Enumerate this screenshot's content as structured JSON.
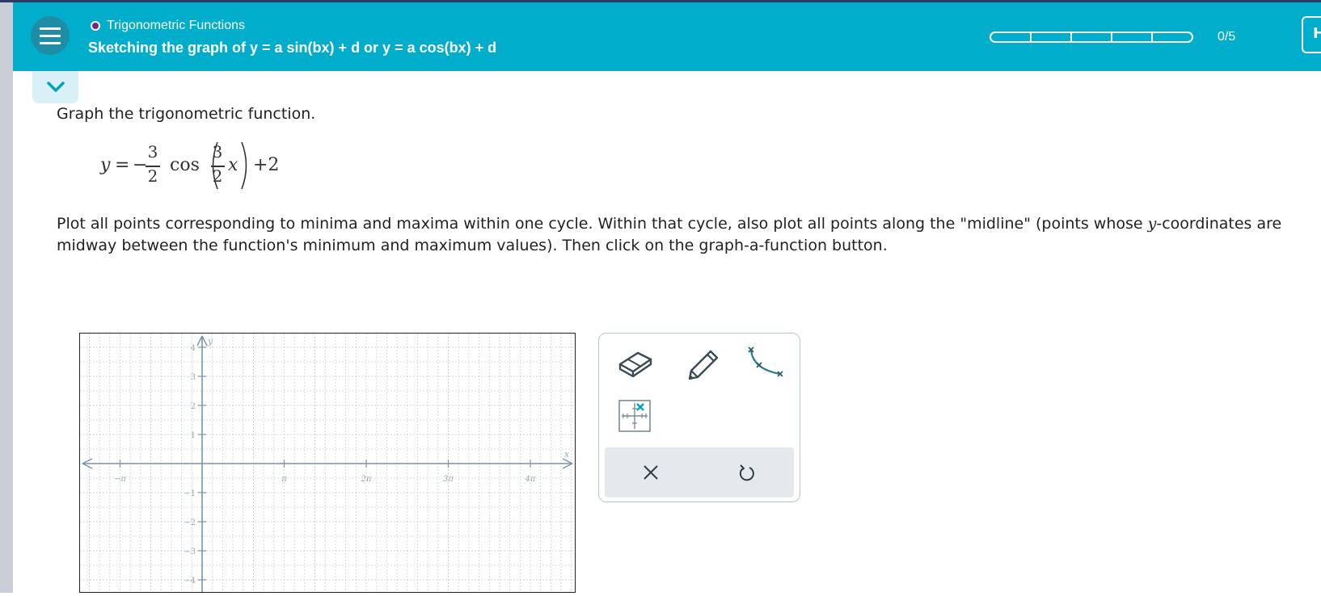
{
  "header": {
    "topic": "Trigonometric Functions",
    "subtitle": "Sketching the graph of y = a sin(bx) + d or y = a cos(bx) + d",
    "progress": {
      "text": "0/5",
      "completed": 0,
      "total": 5
    },
    "right_button_label": "H",
    "colors": {
      "header": "#00aecb",
      "menu": "#1e8ea6",
      "topic_dot": "#6a2a8a"
    }
  },
  "problem": {
    "instruction": "Graph the trigonometric function.",
    "equation": {
      "lhs": "y",
      "equals": "=",
      "sign": "−",
      "coef_num": "3",
      "coef_den": "2",
      "func": "cos",
      "arg_num": "3",
      "arg_den": "2",
      "arg_var": "x",
      "const": "+2"
    },
    "paragraph_before": "Plot all points corresponding to minima and maxima within one cycle. Within that cycle, also plot all points along the \"midline\" (points whose ",
    "paragraph_var": "y",
    "paragraph_after": "-coordinates are midway between the function's minimum and maximum values). Then click on the graph-a-function button."
  },
  "graph": {
    "x_axis_label": "x",
    "y_axis_label": "y",
    "x_ticks": [
      {
        "label": "−π",
        "pi": -1
      },
      {
        "label": "π",
        "pi": 1
      },
      {
        "label": "2π",
        "pi": 2
      },
      {
        "label": "3π",
        "pi": 3
      },
      {
        "label": "4π",
        "pi": 4
      }
    ],
    "y_ticks": [
      {
        "label": "4",
        "v": 4
      },
      {
        "label": "3",
        "v": 3
      },
      {
        "label": "2",
        "v": 2
      },
      {
        "label": "1",
        "v": 1
      },
      {
        "label": "−1",
        "v": -1
      },
      {
        "label": "−2",
        "v": -2
      },
      {
        "label": "−3",
        "v": -3
      },
      {
        "label": "−4",
        "v": -4
      }
    ],
    "xlim_pi": [
      -1.5,
      4.5
    ],
    "ylim": [
      -4.4,
      4.4
    ],
    "minor_step_pi": 0.125,
    "colors": {
      "axis": "#7a94a6",
      "grid": "#c7d2da",
      "label": "#9aa9b3"
    }
  },
  "tools": {
    "items": [
      "eraser-icon",
      "pencil-icon",
      "graph-function-icon",
      "point-grid-icon"
    ],
    "footer": [
      "clear-icon",
      "undo-icon"
    ],
    "accent": "#2e7d8a"
  }
}
